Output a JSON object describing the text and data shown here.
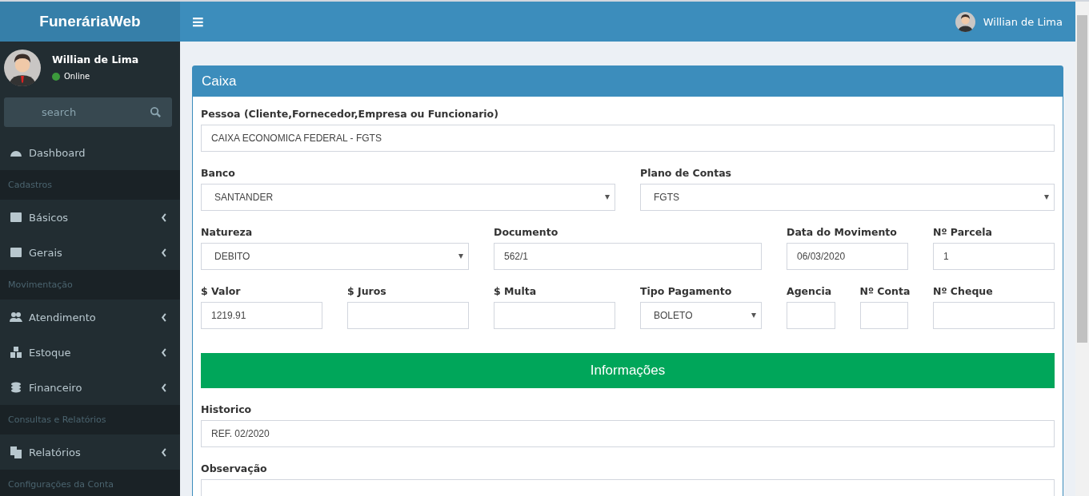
{
  "brand": "FuneráriaWeb",
  "user": {
    "name": "Willian de Lima",
    "status": "Online"
  },
  "search": {
    "placeholder": "search"
  },
  "sidebar": {
    "items": [
      {
        "kind": "link",
        "label": "Dashboard",
        "expandable": false
      },
      {
        "kind": "header",
        "label": "Cadastros"
      },
      {
        "kind": "link",
        "label": "Básicos",
        "expandable": true
      },
      {
        "kind": "link",
        "label": "Gerais",
        "expandable": true
      },
      {
        "kind": "header",
        "label": "Movimentação"
      },
      {
        "kind": "link",
        "label": "Atendimento",
        "expandable": true
      },
      {
        "kind": "link",
        "label": "Estoque",
        "expandable": true
      },
      {
        "kind": "link",
        "label": "Financeiro",
        "expandable": true
      },
      {
        "kind": "header",
        "label": "Consultas e Relatórios"
      },
      {
        "kind": "link",
        "label": "Relatórios",
        "expandable": true
      },
      {
        "kind": "header",
        "label": "Configurações da Conta"
      }
    ]
  },
  "header": {
    "menu_glyph": "≡",
    "user_name": "Willian de Lima"
  },
  "panel": {
    "title": "Caixa",
    "fields": [
      {
        "kind": "text",
        "label": "Pessoa (Cliente,Fornecedor,Empresa ou Funcionario)",
        "value": "CAIXA ECONOMICA FEDERAL - FGTS"
      },
      {
        "kind": "select",
        "label": "Banco",
        "value": "SANTANDER"
      },
      {
        "kind": "select",
        "label": "Plano de Contas",
        "value": "FGTS"
      },
      {
        "kind": "select",
        "label": "Natureza",
        "value": "DEBITO"
      },
      {
        "kind": "text",
        "label": "Documento",
        "value": "562/1"
      },
      {
        "kind": "text",
        "label": "Data do Movimento",
        "value": "06/03/2020"
      },
      {
        "kind": "text",
        "label": "Nº Parcela",
        "value": "1"
      },
      {
        "kind": "text",
        "label": "$ Valor",
        "value": "1219.91"
      },
      {
        "kind": "text",
        "label": "$ Juros"
      },
      {
        "kind": "text",
        "label": "$ Multa"
      },
      {
        "kind": "select",
        "label": "Tipo Pagamento",
        "value": "BOLETO"
      },
      {
        "kind": "text",
        "label": "Agencia"
      },
      {
        "kind": "text",
        "label": "Nº Conta"
      },
      {
        "kind": "text",
        "label": "Nº Cheque"
      },
      {
        "kind": "banner",
        "label": "Informações"
      },
      {
        "kind": "text",
        "label": "Historico",
        "value": "REF. 02/2020"
      },
      {
        "kind": "text",
        "label": "Observação"
      }
    ]
  }
}
